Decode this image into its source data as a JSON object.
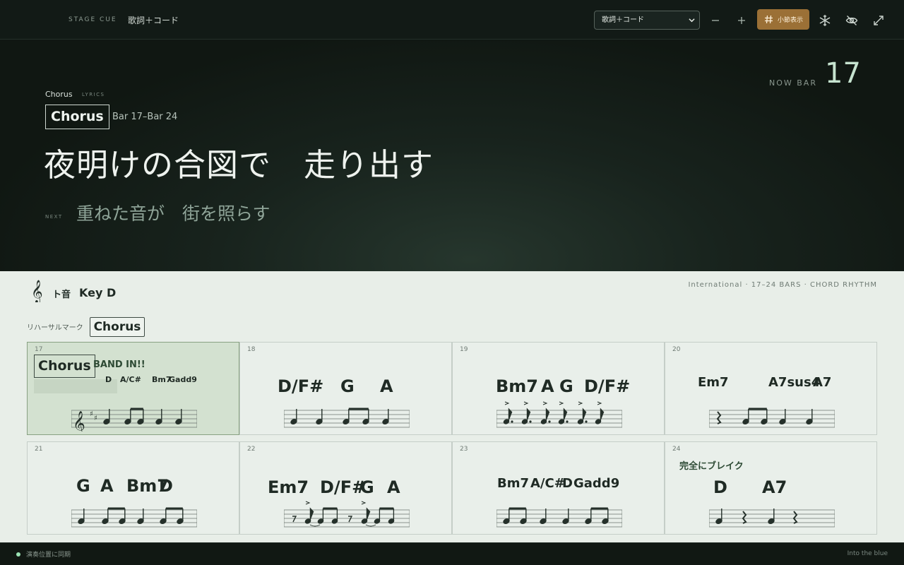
{
  "header": {
    "brand": "STAGE CUE",
    "mode_title": "歌詞＋コード",
    "mode_select": "歌詞＋コード",
    "bar_number_toggle": "小節表示",
    "accent_color": "#9b7036"
  },
  "hero": {
    "now_bar_label": "NOW BAR",
    "now_bar": "17",
    "section_small": "Chorus",
    "section_tag": "LYRICS",
    "section_box": "Chorus",
    "bar_range": "Bar 17–Bar 24",
    "lyric_current": "夜明けの合図で　走り出す",
    "next_label": "NEXT",
    "lyric_next": "重ねた音が　街を照らす"
  },
  "score": {
    "clef_name": "ト音",
    "key": "Key D",
    "meta": "International · 17–24 BARS · CHORD RHYTHM",
    "rehearsal_label": "リハーサルマーク",
    "rehearsal_mark": "Chorus",
    "bars": [
      {
        "num": "17",
        "rehearsal": "Chorus",
        "cue": "BAND IN!!",
        "chords": [
          "D",
          "A/C#",
          "Bm7",
          "Gadd9"
        ]
      },
      {
        "num": "18",
        "chords": [
          "D/F#",
          "G",
          "A"
        ]
      },
      {
        "num": "19",
        "chords": [
          "Bm7",
          "A",
          "G",
          "D/F#"
        ]
      },
      {
        "num": "20",
        "chords": [
          "Em7",
          "A7sus4",
          "A7"
        ]
      },
      {
        "num": "21",
        "chords": [
          "G",
          "A",
          "Bm7",
          "D"
        ]
      },
      {
        "num": "22",
        "chords": [
          "Em7",
          "D/F#",
          "G",
          "A"
        ]
      },
      {
        "num": "23",
        "chords": [
          "Bm7",
          "A/C#",
          "D",
          "Gadd9"
        ]
      },
      {
        "num": "24",
        "cue": "完全にブレイク",
        "chords": [
          "D",
          "A7"
        ]
      }
    ]
  },
  "footer": {
    "sync_label": "演奏位置に同期",
    "song_title": "Into the blue"
  }
}
